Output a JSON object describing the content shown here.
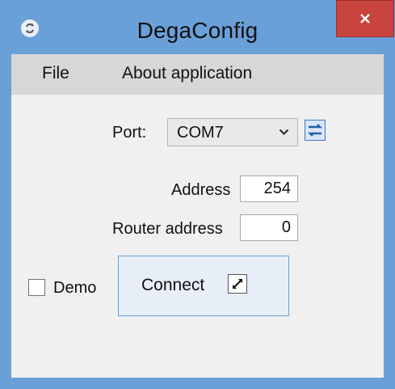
{
  "window": {
    "title": "DegaConfig",
    "icons": {
      "app": "refresh-circle-icon",
      "close": "close-icon"
    },
    "accent_color": "#6aa0d8",
    "close_color": "#c8443d"
  },
  "menu": {
    "items": [
      {
        "label": "File"
      },
      {
        "label": "About application"
      }
    ]
  },
  "form": {
    "port_label": "Port:",
    "port_value": "COM7",
    "address_label": "Address",
    "address_value": "254",
    "router_label": "Router address",
    "router_value": "0",
    "demo_label": "Demo",
    "demo_checked": false,
    "connect_label": "Connect",
    "icons": {
      "dropdown": "chevron-down-icon",
      "refresh_ports": "refresh-ports-icon",
      "connect": "expand-arrows-icon"
    }
  }
}
